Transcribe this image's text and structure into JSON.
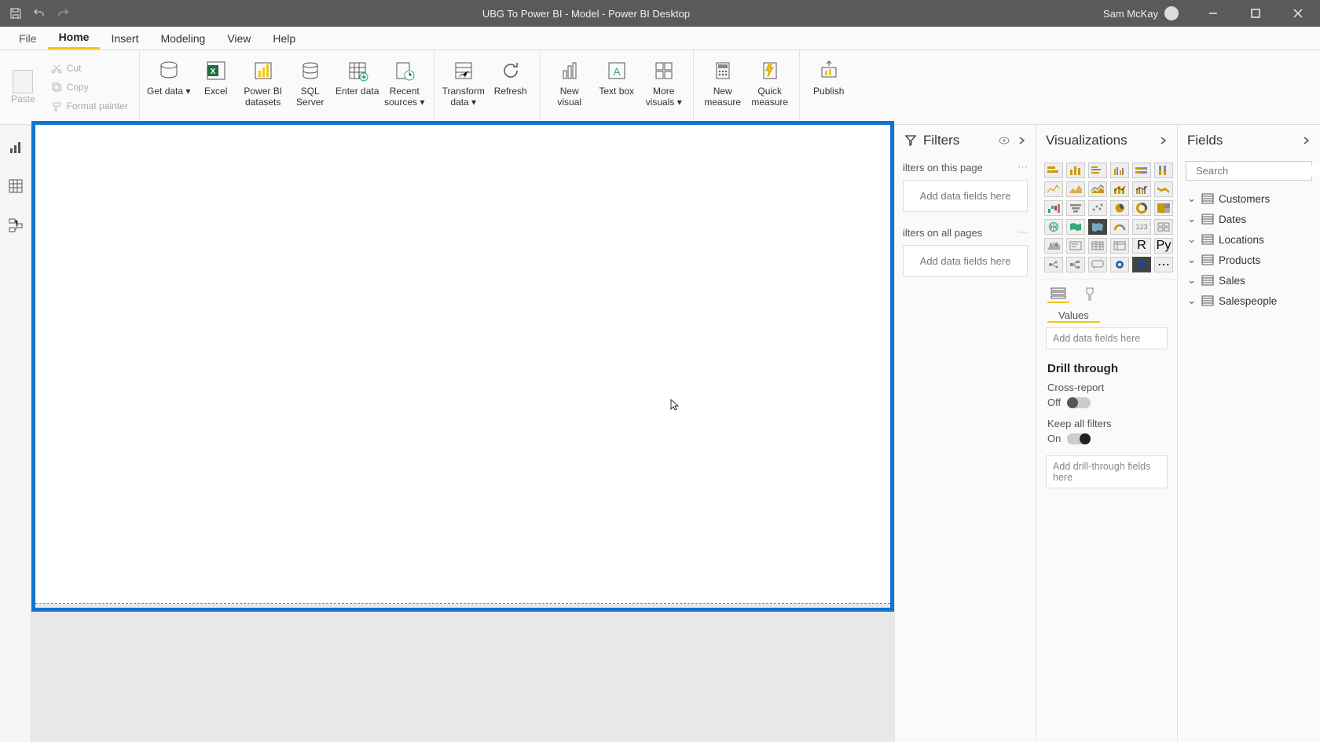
{
  "titlebar": {
    "title": "UBG To Power BI - Model - Power BI Desktop",
    "user": "Sam McKay"
  },
  "menu": {
    "file": "File",
    "tabs": [
      "Home",
      "Insert",
      "Modeling",
      "View",
      "Help"
    ],
    "active": 0
  },
  "ribbon": {
    "clipboard": {
      "paste": "Paste",
      "cut": "Cut",
      "copy": "Copy",
      "format_painter": "Format painter"
    },
    "data": {
      "get_data": "Get data",
      "excel": "Excel",
      "pbi_datasets": "Power BI datasets",
      "sql_server": "SQL Server",
      "enter_data": "Enter data",
      "recent_sources": "Recent sources"
    },
    "queries": {
      "transform": "Transform data",
      "refresh": "Refresh"
    },
    "insert": {
      "new_visual": "New visual",
      "text_box": "Text box",
      "more_visuals": "More visuals"
    },
    "calc": {
      "new_measure": "New measure",
      "quick_measure": "Quick measure"
    },
    "share": {
      "publish": "Publish"
    }
  },
  "filters": {
    "title": "Filters",
    "on_page": "ilters on this page",
    "on_all": "ilters on all pages",
    "add_here": "Add data fields here"
  },
  "viz": {
    "title": "Visualizations",
    "values": "Values",
    "add_here": "Add data fields here",
    "drill_title": "Drill through",
    "cross_report": "Cross-report",
    "off": "Off",
    "keep_filters": "Keep all filters",
    "on": "On",
    "drill_add": "Add drill-through fields here"
  },
  "fields": {
    "title": "Fields",
    "search_placeholder": "Search",
    "items": [
      "Customers",
      "Dates",
      "Locations",
      "Products",
      "Sales",
      "Salespeople"
    ]
  }
}
